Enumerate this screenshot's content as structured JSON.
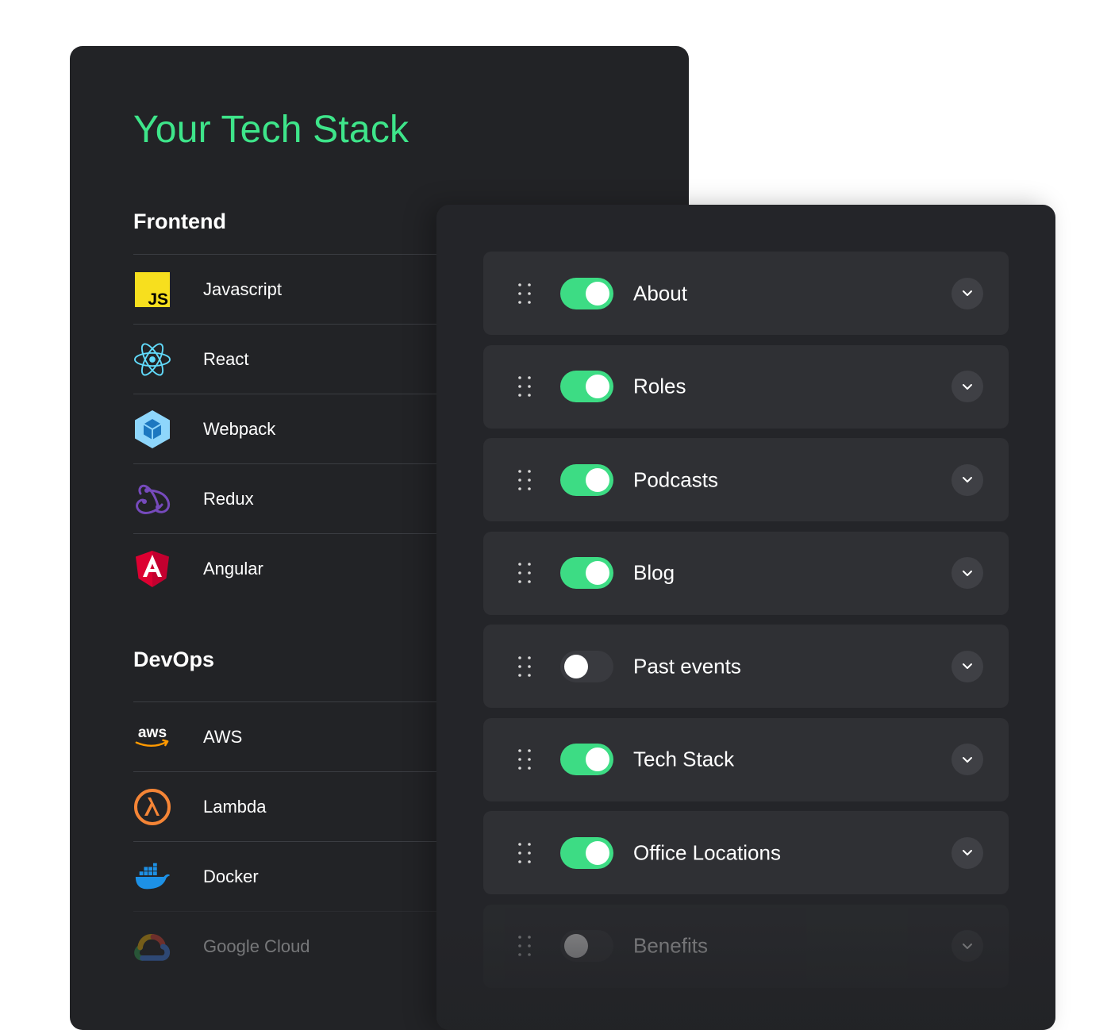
{
  "stack": {
    "title": "Your Tech Stack",
    "frontend": {
      "heading": "Frontend",
      "items": [
        {
          "label": "Javascript",
          "icon": "javascript-icon",
          "icon_text": "JS"
        },
        {
          "label": "React",
          "icon": "react-icon"
        },
        {
          "label": "Webpack",
          "icon": "webpack-icon"
        },
        {
          "label": "Redux",
          "icon": "redux-icon"
        },
        {
          "label": "Angular",
          "icon": "angular-icon"
        }
      ]
    },
    "devops": {
      "heading": "DevOps",
      "items": [
        {
          "label": "AWS",
          "icon": "aws-icon",
          "icon_text": "aws"
        },
        {
          "label": "Lambda",
          "icon": "lambda-icon"
        },
        {
          "label": "Docker",
          "icon": "docker-icon"
        },
        {
          "label": "Google Cloud",
          "icon": "google-cloud-icon"
        }
      ]
    }
  },
  "sections": [
    {
      "label": "About",
      "enabled": true
    },
    {
      "label": "Roles",
      "enabled": true
    },
    {
      "label": "Podcasts",
      "enabled": true
    },
    {
      "label": "Blog",
      "enabled": true
    },
    {
      "label": "Past events",
      "enabled": false
    },
    {
      "label": "Tech Stack",
      "enabled": true
    },
    {
      "label": "Office Locations",
      "enabled": true
    },
    {
      "label": "Benefits",
      "enabled": false
    }
  ],
  "colors": {
    "accent": "#3ee58a",
    "toggle_on": "#3ddc84",
    "panel_back": "#222326",
    "panel_front": "#242529",
    "card": "#2f3034"
  }
}
